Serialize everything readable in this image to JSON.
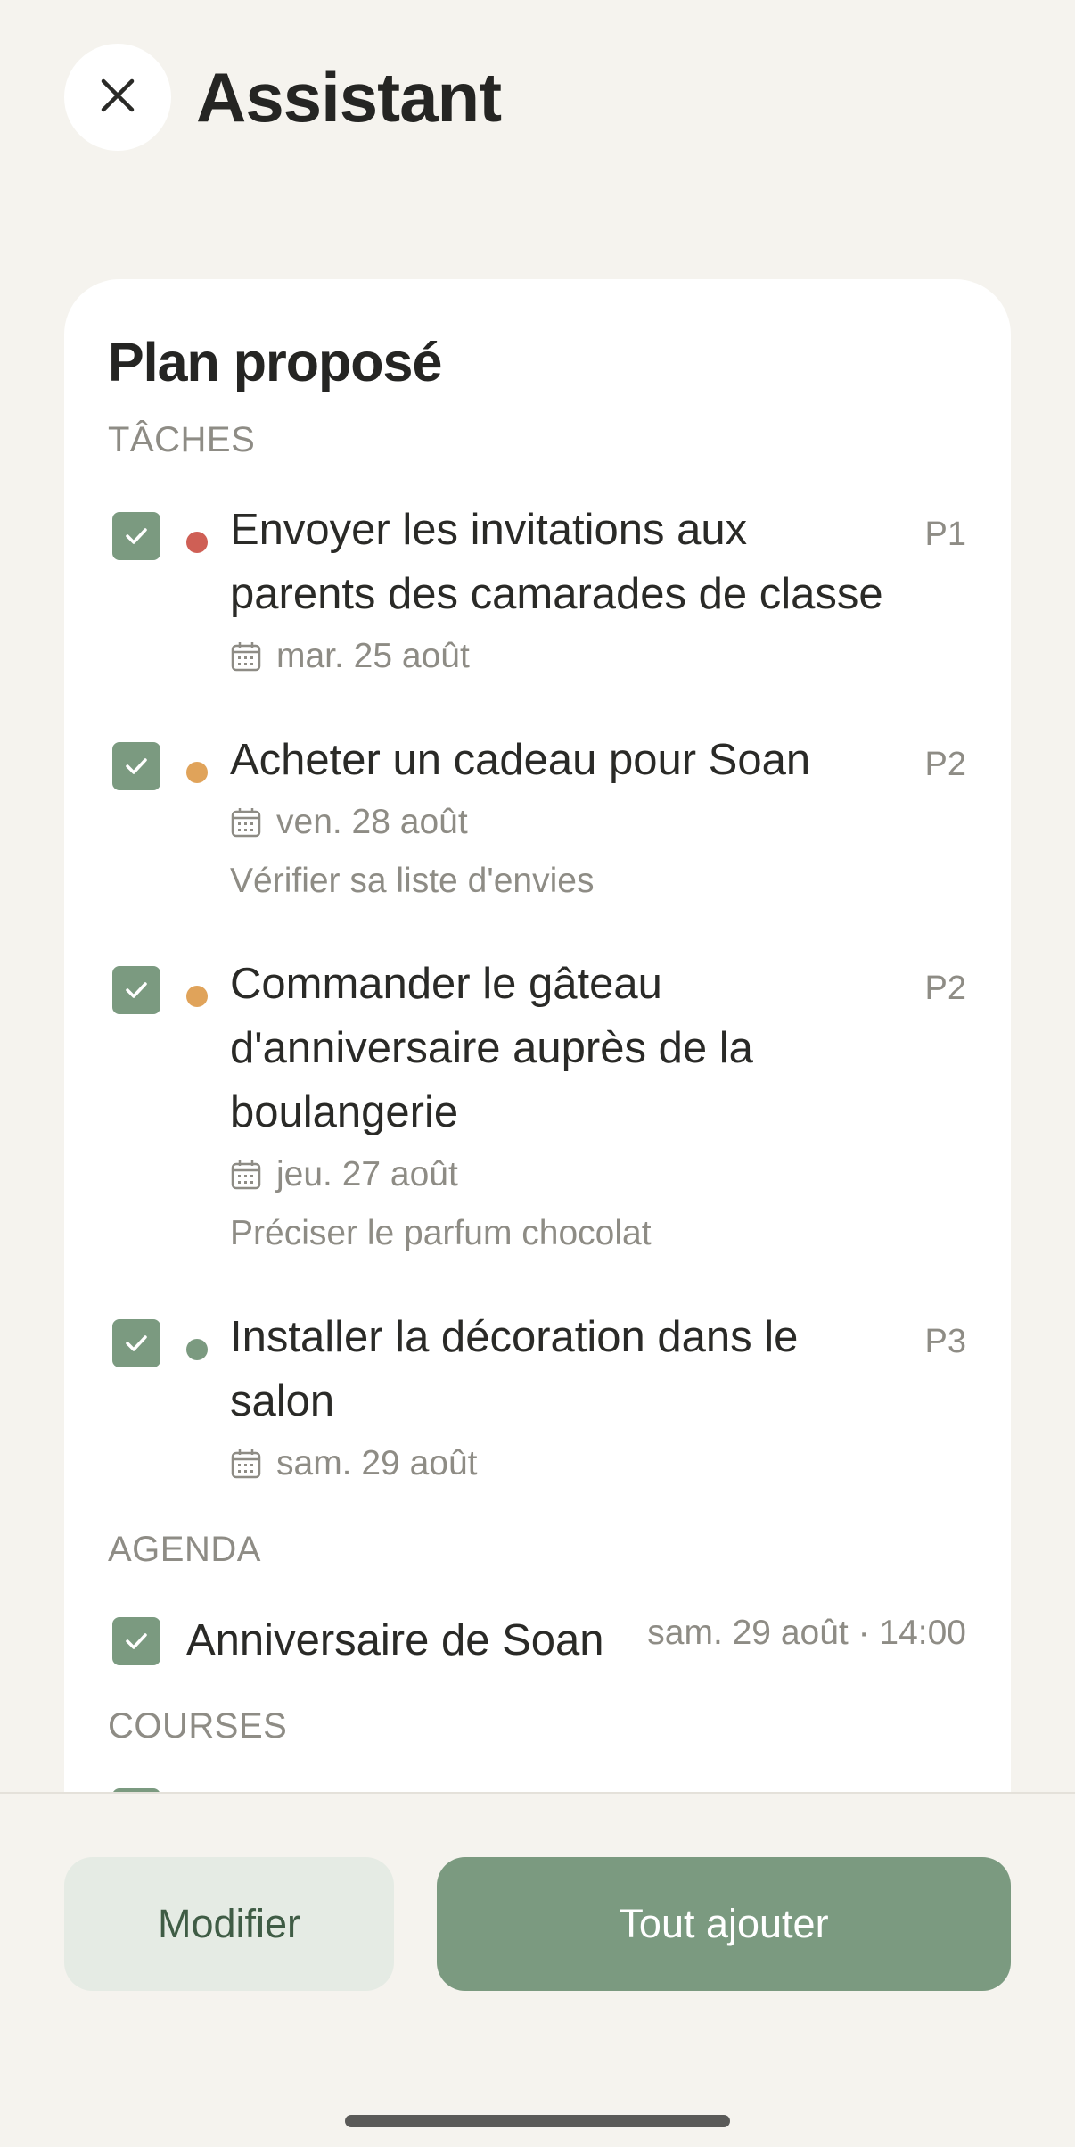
{
  "header": {
    "title": "Assistant",
    "close_icon": "close-icon"
  },
  "plan": {
    "title": "Plan proposé",
    "sections": {
      "tasks_label": "TÂCHES",
      "agenda_label": "AGENDA",
      "courses_label": "COURSES"
    },
    "tasks": [
      {
        "title_lines": [
          "Envoyer les invitations aux",
          "parents des camarades de classe"
        ],
        "priority": "P1",
        "priority_color": "#cf5f55",
        "date": "mar. 25 août",
        "note": "",
        "checked": true
      },
      {
        "title_lines": [
          "Acheter un cadeau pour Soan"
        ],
        "priority": "P2",
        "priority_color": "#e0a35a",
        "date": "ven. 28 août",
        "note": "Vérifier sa liste d'envies",
        "checked": true
      },
      {
        "title_lines": [
          "Commander le gâteau",
          "d'anniversaire auprès de la",
          "boulangerie"
        ],
        "priority": "P2",
        "priority_color": "#e0a35a",
        "date": "jeu. 27 août",
        "note": "Préciser le parfum chocolat",
        "checked": true
      },
      {
        "title_lines": [
          "Installer la décoration dans le",
          "salon"
        ],
        "priority": "P3",
        "priority_color": "#7b9a80",
        "date": "sam. 29 août",
        "note": "",
        "checked": true
      }
    ],
    "agenda": [
      {
        "title": "Anniversaire de Soan",
        "when": "sam. 29 août · 14:00",
        "checked": true
      }
    ]
  },
  "footer": {
    "modify_label": "Modifier",
    "add_all_label": "Tout ajouter"
  },
  "colors": {
    "accent": "#7b9a80",
    "background": "#f5f3ee",
    "card": "#ffffff",
    "muted_text": "#8e8c85"
  }
}
